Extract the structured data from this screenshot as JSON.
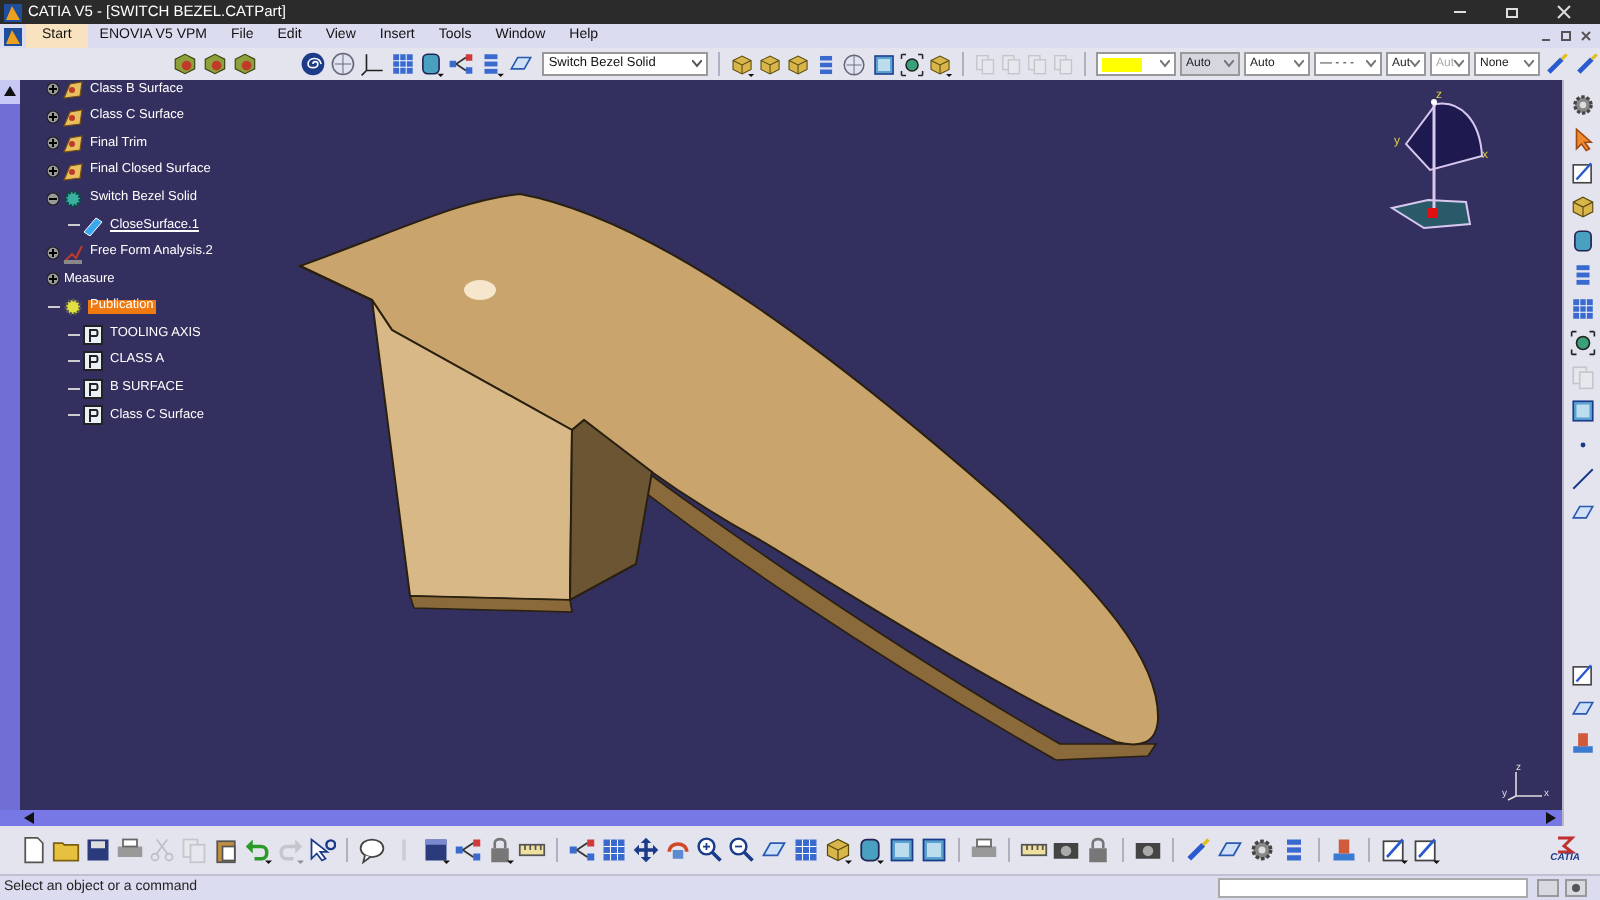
{
  "window": {
    "title": "CATIA V5 - [SWITCH BEZEL.CATPart]"
  },
  "menu": [
    {
      "label": "Start",
      "selected": true
    },
    {
      "label": "ENOVIA V5 VPM",
      "selected": false
    },
    {
      "label": "File",
      "selected": false
    },
    {
      "label": "Edit",
      "selected": false
    },
    {
      "label": "View",
      "selected": false
    },
    {
      "label": "Insert",
      "selected": false
    },
    {
      "label": "Tools",
      "selected": false
    },
    {
      "label": "Window",
      "selected": false
    },
    {
      "label": "Help",
      "selected": false
    }
  ],
  "toolbar": {
    "body_combo": "Switch Bezel Solid",
    "properties": [
      {
        "kind": "color",
        "color": "#ffff00"
      },
      {
        "kind": "text",
        "value": "Auto",
        "disabled": true
      },
      {
        "kind": "text",
        "value": "Auto",
        "disabled": false
      },
      {
        "kind": "text",
        "value": "— - - -",
        "disabled": false
      },
      {
        "kind": "text",
        "value": "Aut",
        "disabled": false
      },
      {
        "kind": "text",
        "value": "Aut",
        "disabled": true
      },
      {
        "kind": "text",
        "value": "None",
        "disabled": false
      }
    ]
  },
  "tree": [
    {
      "label": "Class B Surface",
      "kind": "surface",
      "expanded": false,
      "selected": false
    },
    {
      "label": "Class C Surface",
      "kind": "surface",
      "expanded": false,
      "selected": false
    },
    {
      "label": "Final Trim",
      "kind": "surface",
      "expanded": false,
      "selected": false
    },
    {
      "label": "Final Closed Surface",
      "kind": "surface",
      "expanded": false,
      "selected": false
    },
    {
      "label": "Switch Bezel Solid",
      "kind": "solid",
      "expanded": true,
      "selected": false,
      "children": [
        {
          "label": "CloseSurface.1",
          "kind": "close-surface",
          "current": true,
          "selected": false
        }
      ]
    },
    {
      "label": "Free Form Analysis.2",
      "kind": "analysis",
      "expanded": false,
      "selected": false
    },
    {
      "label": "Measure",
      "kind": "measure",
      "expanded": false,
      "selected": false
    },
    {
      "label": "Publication",
      "kind": "publication",
      "selected": true,
      "children": [
        {
          "label": "TOOLING AXIS",
          "kind": "published",
          "selected": false
        },
        {
          "label": "CLASS A",
          "kind": "published",
          "selected": false
        },
        {
          "label": "B SURFACE",
          "kind": "published",
          "selected": false
        },
        {
          "label": "Class C Surface",
          "kind": "published",
          "selected": false
        }
      ]
    }
  ],
  "compass": {
    "labels": [
      "z",
      "y",
      "x"
    ]
  },
  "axis_triad": {
    "labels": [
      "z",
      "y",
      "x"
    ]
  },
  "logo_text": "CATIA",
  "status_bar": {
    "message": "Select an object or a command"
  }
}
